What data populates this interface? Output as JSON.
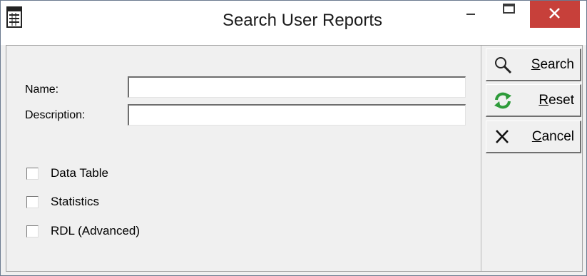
{
  "window": {
    "title": "Search User Reports"
  },
  "form": {
    "name_label": "Name:",
    "name_value": "",
    "description_label": "Description:",
    "description_value": ""
  },
  "checkboxes": [
    {
      "label": "Data Table",
      "checked": false
    },
    {
      "label": "Statistics",
      "checked": false
    },
    {
      "label": "RDL (Advanced)",
      "checked": false
    }
  ],
  "buttons": {
    "search": "Search",
    "reset": "Reset",
    "cancel": "Cancel"
  },
  "icons": {
    "app": "report-calendar-icon",
    "search": "magnifier-icon",
    "reset": "refresh-icon",
    "cancel": "close-x-icon"
  },
  "colors": {
    "close_button": "#c7403a",
    "reset_icon": "#2e9b3a"
  }
}
